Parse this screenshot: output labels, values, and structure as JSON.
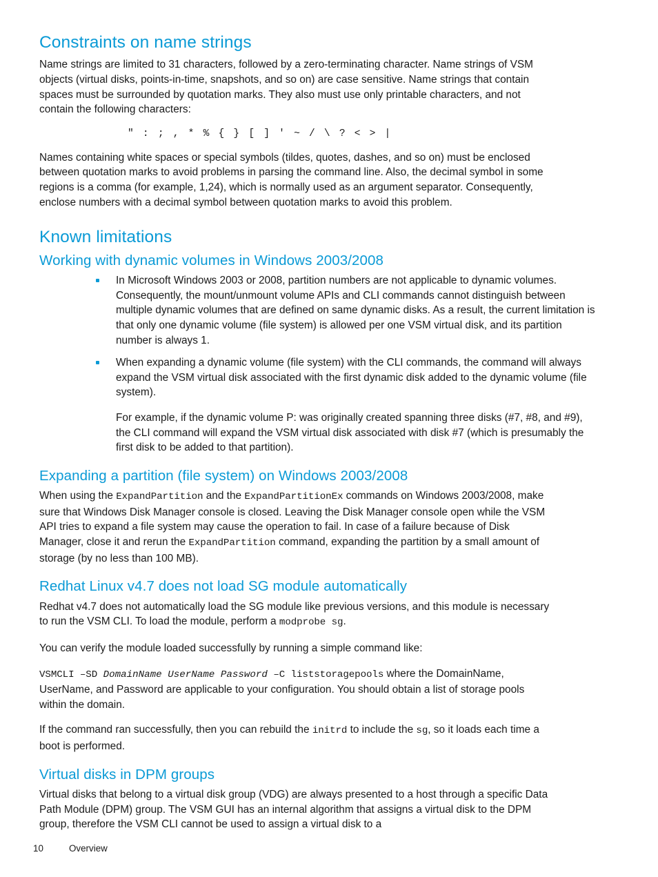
{
  "page": {
    "number": "10",
    "chapter": "Overview"
  },
  "colors": {
    "heading_blue": "#0a9ad6",
    "body_text": "#1a1a1a",
    "bullet": "#0a9ad6",
    "background": "#ffffff"
  },
  "sections": [
    {
      "id": "constraints-on-name-strings",
      "level": 1,
      "heading": "Constraints on name strings",
      "paragraph_1": "Name strings are limited to 31 characters, followed by a zero-terminating character. Name strings of VSM objects (virtual disks, points-in-time, snapshots, and so on) are case sensitive. Name strings that contain spaces must be surrounded by quotation marks. They also must use only printable characters, and not contain the following characters:",
      "forbidden_characters": "\" : ; , * % { } [ ] ' ~ / \\ ? < > |",
      "paragraph_2": "Names containing white spaces or special symbols (tildes, quotes, dashes, and so on) must be enclosed between quotation marks to avoid problems in parsing the command line. Also, the decimal symbol in some regions is a comma (for example, 1,24), which is normally used as an argument separator. Consequently, enclose numbers with a decimal symbol between quotation marks to avoid this problem."
    },
    {
      "id": "known-limitations",
      "level": 1,
      "heading": "Known limitations"
    },
    {
      "id": "working-with-dynamic-volumes",
      "level": 2,
      "heading": "Working with dynamic volumes in Windows 2003/2008",
      "bullets": [
        {
          "text": "In Microsoft Windows 2003 or 2008, partition numbers are not applicable to dynamic volumes. Consequently, the mount/unmount volume APIs and CLI commands cannot distinguish between multiple dynamic volumes that are defined on same dynamic disks. As a result, the current limitation is that only one dynamic volume (file system) is allowed per one VSM virtual disk, and its partition number is always 1."
        },
        {
          "text": "When expanding a dynamic volume (file system) with the CLI commands, the command will always expand the VSM virtual disk associated with the first dynamic disk added to the dynamic volume (file system).",
          "sub_paragraph": "For example, if the dynamic volume P: was originally created spanning three disks (#7, #8, and #9), the CLI command will expand the VSM virtual disk associated with disk #7 (which is presumably the first disk to be added to that partition)."
        }
      ]
    },
    {
      "id": "expanding-a-partition",
      "level": 2,
      "heading": "Expanding a partition (file system) on Windows 2003/2008",
      "paragraph_parts": {
        "t1": "When using the ",
        "code1": "ExpandPartition",
        "t2": " and the ",
        "code2": "ExpandPartitionEx",
        "t3": " commands on Windows 2003/2008, make sure that Windows Disk Manager console is closed. Leaving the Disk Manager console open while the VSM API tries to expand a file system may cause the operation to fail. In case of a failure because of Disk Manager, close it and rerun the ",
        "code3": "ExpandPartition",
        "t4": " command, expanding the partition by a small amount of storage (by no less than 100 MB)."
      }
    },
    {
      "id": "redhat-linux-sg-module",
      "level": 2,
      "heading": "Redhat Linux v4.7 does not load SG module automatically",
      "paragraph_1_parts": {
        "t1": "Redhat v4.7 does not automatically load the SG module like previous versions, and this module is necessary to run the VSM CLI. To load the module, perform a ",
        "code1": "modprobe sg",
        "t2": "."
      },
      "paragraph_2": "You can verify the module loaded successfully by running a simple command like:",
      "paragraph_3_parts": {
        "code_cmd": "VSMCLI –SD ",
        "code_italic": "DomainName UserName Password",
        "code_cmd2": " –C liststoragepools",
        "t1": " where the DomainName, UserName, and Password are applicable to your configuration. You should obtain a list of storage pools within the domain."
      },
      "paragraph_4_parts": {
        "t1": "If the command ran successfully, then you can rebuild the ",
        "code1": "initrd",
        "t2": " to include the ",
        "code2": "sg",
        "t3": ", so it loads each time a boot is performed."
      }
    },
    {
      "id": "virtual-disks-in-dpm-groups",
      "level": 2,
      "heading": "Virtual disks in DPM groups",
      "paragraph_1": "Virtual disks that belong to a virtual disk group (VDG) are always presented to a host through a specific Data Path Module (DPM) group. The VSM GUI has an internal algorithm that assigns a virtual disk to the DPM group, therefore the VSM CLI cannot be used to assign a virtual disk to a"
    }
  ]
}
